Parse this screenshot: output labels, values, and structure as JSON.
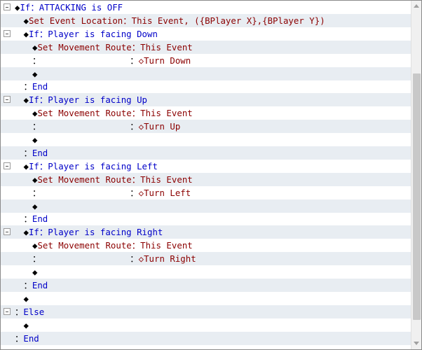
{
  "rows": [
    {
      "fold": true,
      "alt": false,
      "indent": 0,
      "parts": [
        {
          "t": "◆",
          "c": "k"
        },
        {
          "t": "If：ATTACKING is OFF",
          "c": "if"
        }
      ]
    },
    {
      "fold": false,
      "alt": true,
      "indent": 1,
      "parts": [
        {
          "t": "◆",
          "c": "k"
        },
        {
          "t": "Set Event Location：This Event, ({BPlayer X},{BPlayer Y})",
          "c": "cmd"
        }
      ]
    },
    {
      "fold": true,
      "alt": false,
      "indent": 1,
      "parts": [
        {
          "t": "◆",
          "c": "k"
        },
        {
          "t": "If：Player is facing Down",
          "c": "if"
        }
      ]
    },
    {
      "fold": false,
      "alt": true,
      "indent": 2,
      "parts": [
        {
          "t": "◆",
          "c": "k"
        },
        {
          "t": "Set Movement Route：This Event",
          "c": "cmd"
        }
      ]
    },
    {
      "fold": false,
      "alt": false,
      "indent": 2,
      "parts": [
        {
          "t": "：                 ：",
          "c": "k"
        },
        {
          "t": "◇Turn Down",
          "c": "cmd"
        }
      ]
    },
    {
      "fold": false,
      "alt": true,
      "indent": 2,
      "parts": [
        {
          "t": "◆",
          "c": "k"
        }
      ]
    },
    {
      "fold": false,
      "alt": false,
      "indent": 1,
      "parts": [
        {
          "t": "：",
          "c": "k"
        },
        {
          "t": "End",
          "c": "if"
        }
      ]
    },
    {
      "fold": true,
      "alt": true,
      "indent": 1,
      "parts": [
        {
          "t": "◆",
          "c": "k"
        },
        {
          "t": "If：Player is facing Up",
          "c": "if"
        }
      ]
    },
    {
      "fold": false,
      "alt": false,
      "indent": 2,
      "parts": [
        {
          "t": "◆",
          "c": "k"
        },
        {
          "t": "Set Movement Route：This Event",
          "c": "cmd"
        }
      ]
    },
    {
      "fold": false,
      "alt": true,
      "indent": 2,
      "parts": [
        {
          "t": "：                 ：",
          "c": "k"
        },
        {
          "t": "◇Turn Up",
          "c": "cmd"
        }
      ]
    },
    {
      "fold": false,
      "alt": false,
      "indent": 2,
      "parts": [
        {
          "t": "◆",
          "c": "k"
        }
      ]
    },
    {
      "fold": false,
      "alt": true,
      "indent": 1,
      "parts": [
        {
          "t": "：",
          "c": "k"
        },
        {
          "t": "End",
          "c": "if"
        }
      ]
    },
    {
      "fold": true,
      "alt": false,
      "indent": 1,
      "parts": [
        {
          "t": "◆",
          "c": "k"
        },
        {
          "t": "If：Player is facing Left",
          "c": "if"
        }
      ]
    },
    {
      "fold": false,
      "alt": true,
      "indent": 2,
      "parts": [
        {
          "t": "◆",
          "c": "k"
        },
        {
          "t": "Set Movement Route：This Event",
          "c": "cmd"
        }
      ]
    },
    {
      "fold": false,
      "alt": false,
      "indent": 2,
      "parts": [
        {
          "t": "：                 ：",
          "c": "k"
        },
        {
          "t": "◇Turn Left",
          "c": "cmd"
        }
      ]
    },
    {
      "fold": false,
      "alt": true,
      "indent": 2,
      "parts": [
        {
          "t": "◆",
          "c": "k"
        }
      ]
    },
    {
      "fold": false,
      "alt": false,
      "indent": 1,
      "parts": [
        {
          "t": "：",
          "c": "k"
        },
        {
          "t": "End",
          "c": "if"
        }
      ]
    },
    {
      "fold": true,
      "alt": true,
      "indent": 1,
      "parts": [
        {
          "t": "◆",
          "c": "k"
        },
        {
          "t": "If：Player is facing Right",
          "c": "if"
        }
      ]
    },
    {
      "fold": false,
      "alt": false,
      "indent": 2,
      "parts": [
        {
          "t": "◆",
          "c": "k"
        },
        {
          "t": "Set Movement Route：This Event",
          "c": "cmd"
        }
      ]
    },
    {
      "fold": false,
      "alt": true,
      "indent": 2,
      "parts": [
        {
          "t": "：                 ：",
          "c": "k"
        },
        {
          "t": "◇Turn Right",
          "c": "cmd"
        }
      ]
    },
    {
      "fold": false,
      "alt": false,
      "indent": 2,
      "parts": [
        {
          "t": "◆",
          "c": "k"
        }
      ]
    },
    {
      "fold": false,
      "alt": true,
      "indent": 1,
      "parts": [
        {
          "t": "：",
          "c": "k"
        },
        {
          "t": "End",
          "c": "if"
        }
      ]
    },
    {
      "fold": false,
      "alt": false,
      "indent": 1,
      "parts": [
        {
          "t": "◆",
          "c": "k"
        }
      ]
    },
    {
      "fold": true,
      "alt": true,
      "indent": 0,
      "parts": [
        {
          "t": "：",
          "c": "k"
        },
        {
          "t": "Else",
          "c": "if"
        }
      ]
    },
    {
      "fold": false,
      "alt": false,
      "indent": 1,
      "parts": [
        {
          "t": "◆",
          "c": "k"
        }
      ]
    },
    {
      "fold": false,
      "alt": true,
      "indent": 0,
      "parts": [
        {
          "t": "：",
          "c": "k"
        },
        {
          "t": "End",
          "c": "if"
        }
      ]
    }
  ],
  "colors": {
    "command": "#8b0000",
    "branch": "#0000c8",
    "row_alt": "#e8edf2"
  },
  "icons": {
    "fold": "fold-collapse-icon",
    "scroll_up": "arrow-up-icon",
    "scroll_down": "arrow-down-icon"
  }
}
